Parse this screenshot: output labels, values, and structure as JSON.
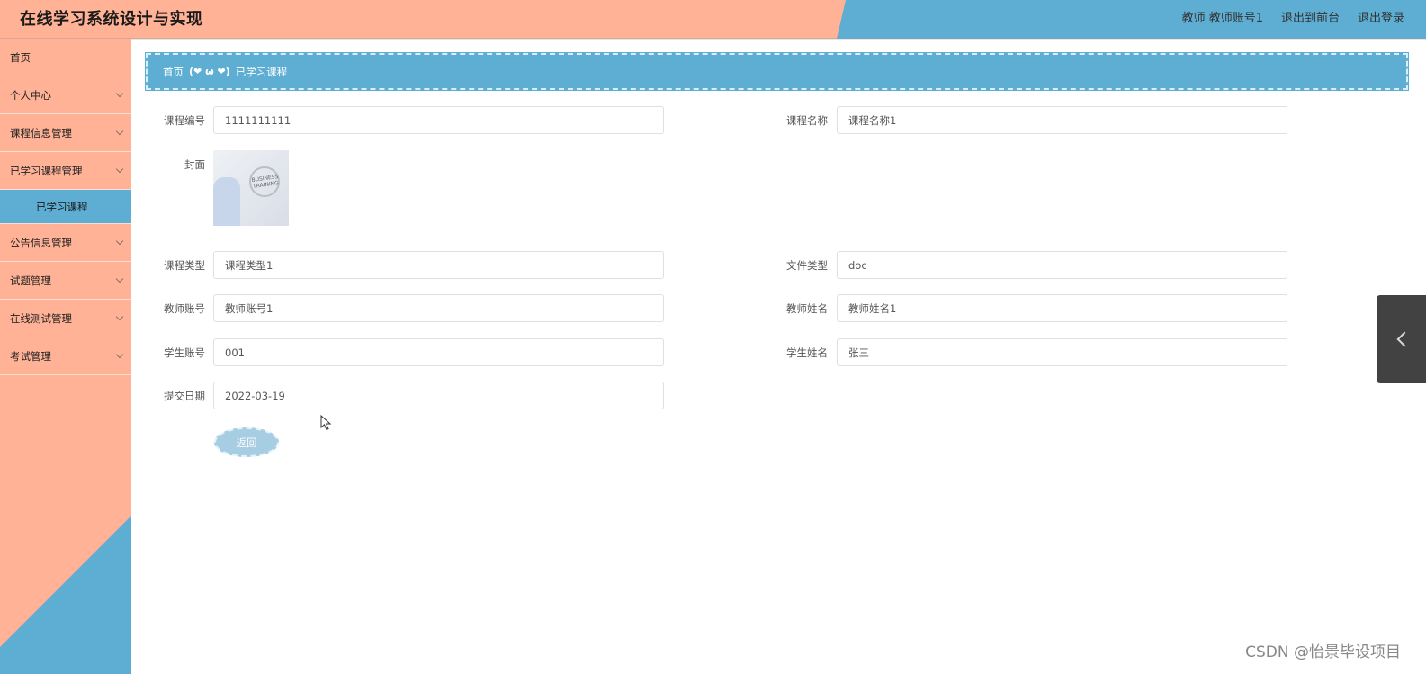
{
  "header": {
    "title": "在线学习系统设计与实现",
    "user": "教师 教师账号1",
    "back_to_front": "退出到前台",
    "logout": "退出登录"
  },
  "sidebar": {
    "items": [
      {
        "label": "首页",
        "expandable": false
      },
      {
        "label": "个人中心",
        "expandable": true
      },
      {
        "label": "课程信息管理",
        "expandable": true
      },
      {
        "label": "已学习课程管理",
        "expandable": true
      },
      {
        "label": "公告信息管理",
        "expandable": true
      },
      {
        "label": "试题管理",
        "expandable": true
      },
      {
        "label": "在线测试管理",
        "expandable": true
      },
      {
        "label": "考试管理",
        "expandable": true
      }
    ],
    "active_sub_item": "已学习课程"
  },
  "breadcrumb": {
    "home": "首页",
    "separator": "(❤ ω ❤)",
    "current": "已学习课程"
  },
  "form": {
    "course_no": {
      "label": "课程编号",
      "value": "1111111111"
    },
    "course_name": {
      "label": "课程名称",
      "value": "课程名称1"
    },
    "cover": {
      "label": "封面",
      "image_text": "BUSINESS TRAINING"
    },
    "course_type": {
      "label": "课程类型",
      "value": "课程类型1"
    },
    "file_type": {
      "label": "文件类型",
      "value": "doc"
    },
    "teacher_account": {
      "label": "教师账号",
      "value": "教师账号1"
    },
    "teacher_name": {
      "label": "教师姓名",
      "value": "教师姓名1"
    },
    "student_account": {
      "label": "学生账号",
      "value": "001"
    },
    "student_name": {
      "label": "学生姓名",
      "value": "张三"
    },
    "submit_date": {
      "label": "提交日期",
      "value": "2022-03-19"
    },
    "back_label": "返回"
  },
  "watermark": "CSDN @怡景毕设项目",
  "colors": {
    "salmon": "#ffb296",
    "blue": "#5eadd3",
    "button": "#a7cde2"
  }
}
